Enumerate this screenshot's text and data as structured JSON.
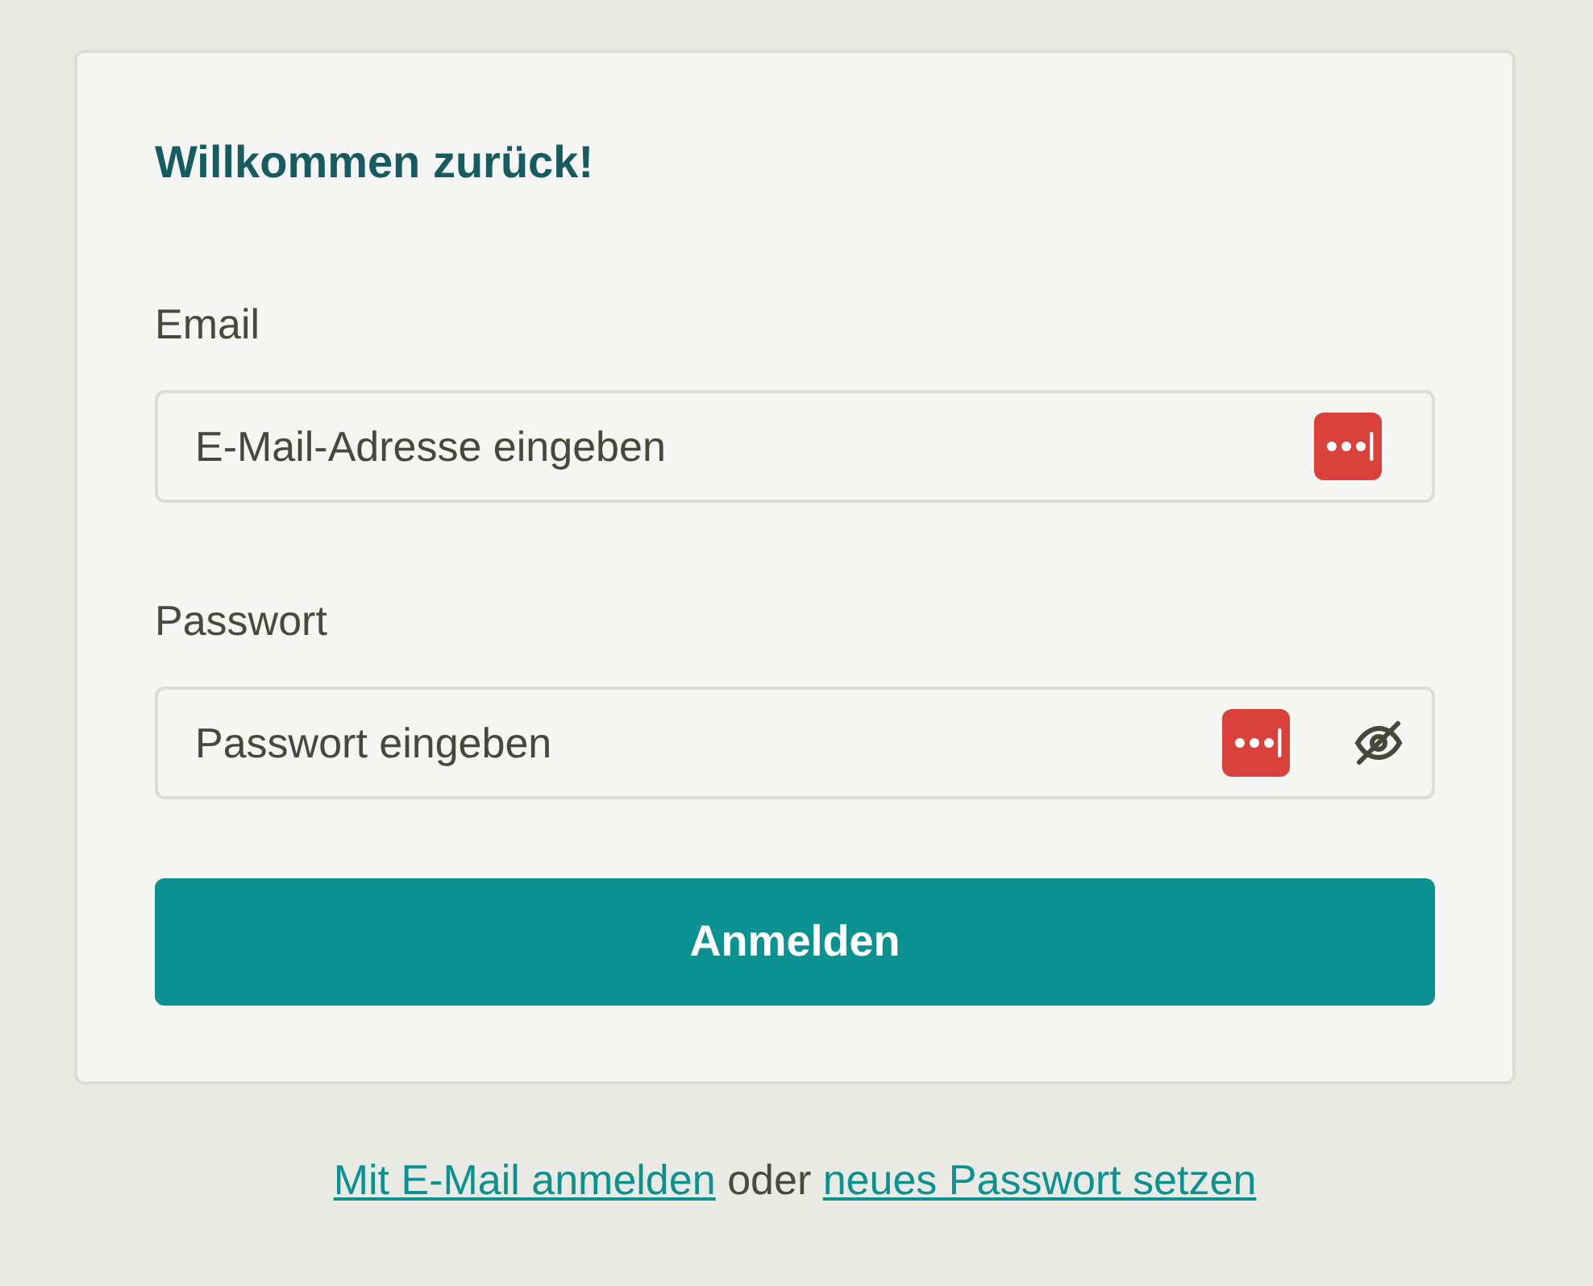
{
  "card": {
    "title": "Willkommen zurück!",
    "fields": [
      {
        "kind": "email",
        "label": "Email",
        "placeholder": "E-Mail-Adresse eingeben"
      },
      {
        "kind": "password",
        "label": "Passwort",
        "placeholder": "Passwort eingeben"
      }
    ],
    "submit": "Anmelden"
  },
  "footer": [
    {
      "kind": "link",
      "text": "Mit E-Mail anmelden"
    },
    {
      "kind": "text",
      "text": "oder"
    },
    {
      "kind": "link",
      "text": "neues Passwort setzen"
    }
  ]
}
